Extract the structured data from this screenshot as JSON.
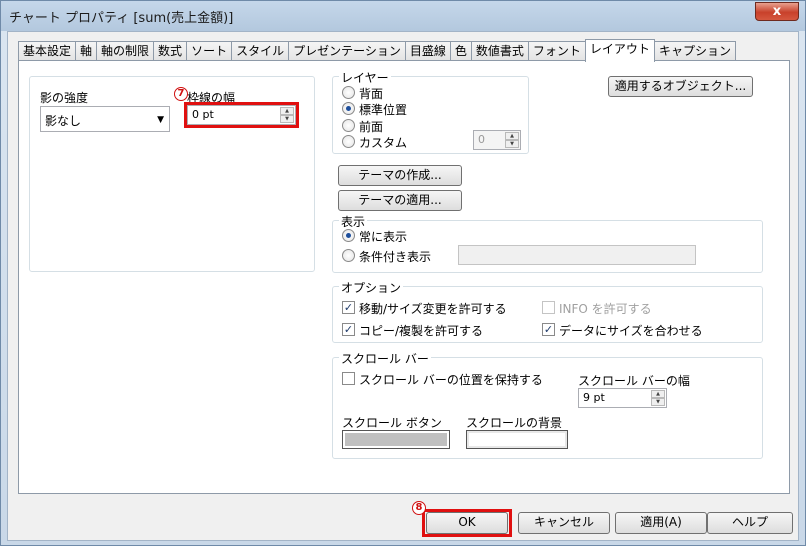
{
  "window": {
    "title": "チャート プロパティ [sum(売上金額)]",
    "close_label": "x"
  },
  "tabs": [
    "基本設定",
    "軸",
    "軸の制限",
    "数式",
    "ソート",
    "スタイル",
    "プレゼンテーション",
    "目盛線",
    "色",
    "数値書式",
    "フォント",
    "レイアウト",
    "キャプション"
  ],
  "active_tab": "レイアウト",
  "shadow": {
    "label": "影の強度",
    "value": "影なし"
  },
  "border": {
    "label": "枠線の幅",
    "value": "0 pt",
    "step_marker": "7"
  },
  "layer": {
    "title": "レイヤー",
    "options": [
      "背面",
      "標準位置",
      "前面",
      "カスタム"
    ],
    "selected": "標準位置",
    "custom_value": "0"
  },
  "apply_object_button": "適用するオブジェクト...",
  "theme": {
    "create_button": "テーマの作成...",
    "apply_button": "テーマの適用..."
  },
  "display": {
    "title": "表示",
    "options": [
      "常に表示",
      "条件付き表示"
    ],
    "selected": "常に表示"
  },
  "options": {
    "title": "オプション",
    "allow_move": "移動/サイズ変更を許可する",
    "allow_copy": "コピー/複製を許可する",
    "allow_info": "INFO を許可する",
    "fit_size": "データにサイズを合わせる",
    "allow_move_checked": true,
    "allow_copy_checked": true,
    "allow_info_checked": false,
    "fit_size_checked": true
  },
  "scrollbar": {
    "title": "スクロール バー",
    "keep_position": "スクロール バーの位置を保持する",
    "width_label": "スクロール バーの幅",
    "width_value": "9 pt",
    "button_label": "スクロール ボタン",
    "background_label": "スクロールの背景",
    "button_color": "#c0c0c0",
    "background_color": "#ffffff"
  },
  "footer": {
    "ok": "OK",
    "cancel": "キャンセル",
    "apply": "適用(A)",
    "help": "ヘルプ",
    "step_marker": "8"
  },
  "colors": {
    "highlight": "#e01010",
    "radio_dot": "#1e4f9c"
  }
}
